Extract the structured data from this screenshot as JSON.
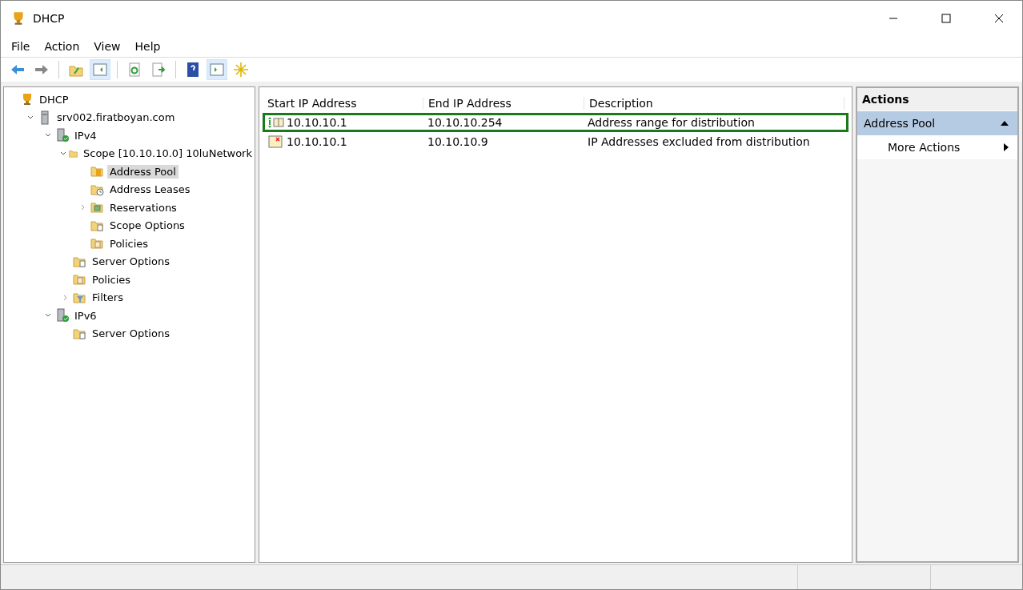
{
  "window": {
    "title": "DHCP"
  },
  "menu": [
    "File",
    "Action",
    "View",
    "Help"
  ],
  "toolbar": [
    {
      "kind": "back",
      "pressed": false
    },
    {
      "kind": "forward",
      "pressed": false
    },
    {
      "kind": "sep"
    },
    {
      "kind": "up",
      "pressed": false
    },
    {
      "kind": "tree",
      "pressed": true
    },
    {
      "kind": "sep"
    },
    {
      "kind": "refresh",
      "pressed": false
    },
    {
      "kind": "export",
      "pressed": false
    },
    {
      "kind": "sep"
    },
    {
      "kind": "help",
      "pressed": false
    },
    {
      "kind": "pane",
      "pressed": true
    },
    {
      "kind": "star",
      "pressed": false
    }
  ],
  "tree": [
    {
      "label": "DHCP",
      "kind": "root",
      "selected": false,
      "children": [
        {
          "label": "srv002.firatboyan.com",
          "kind": "server",
          "expanded": true,
          "selected": false,
          "children": [
            {
              "label": "IPv4",
              "kind": "ipserver",
              "expanded": true,
              "selected": false,
              "children": [
                {
                  "label": "Scope [10.10.10.0] 10luNetwork",
                  "kind": "folder",
                  "expanded": true,
                  "selected": false,
                  "children": [
                    {
                      "label": "Address Pool",
                      "kind": "pool",
                      "selected": true
                    },
                    {
                      "label": "Address Leases",
                      "kind": "leases",
                      "selected": false
                    },
                    {
                      "label": "Reservations",
                      "kind": "reservations",
                      "expanded": false,
                      "selected": false
                    },
                    {
                      "label": "Scope Options",
                      "kind": "options",
                      "selected": false
                    },
                    {
                      "label": "Policies",
                      "kind": "policies",
                      "selected": false
                    }
                  ]
                },
                {
                  "label": "Server Options",
                  "kind": "options",
                  "selected": false
                },
                {
                  "label": "Policies",
                  "kind": "policies",
                  "selected": false
                },
                {
                  "label": "Filters",
                  "kind": "filters",
                  "expanded": false,
                  "selected": false
                }
              ]
            },
            {
              "label": "IPv6",
              "kind": "ipserver",
              "expanded": true,
              "selected": false,
              "children": [
                {
                  "label": "Server Options",
                  "kind": "options",
                  "selected": false
                }
              ]
            }
          ]
        }
      ]
    }
  ],
  "table": {
    "columns": [
      "Start IP Address",
      "End IP Address",
      "Description"
    ],
    "rows": [
      {
        "kind": "pool",
        "highlighted": true,
        "cells": [
          "10.10.10.1",
          "10.10.10.254",
          "Address range for distribution"
        ]
      },
      {
        "kind": "exclusion",
        "highlighted": false,
        "cells": [
          "10.10.10.1",
          "10.10.10.9",
          "IP Addresses excluded from distribution"
        ]
      }
    ]
  },
  "actions": {
    "title": "Actions",
    "section": {
      "label": "Address Pool",
      "expanded": true
    },
    "items": [
      {
        "label": "More Actions"
      }
    ]
  }
}
